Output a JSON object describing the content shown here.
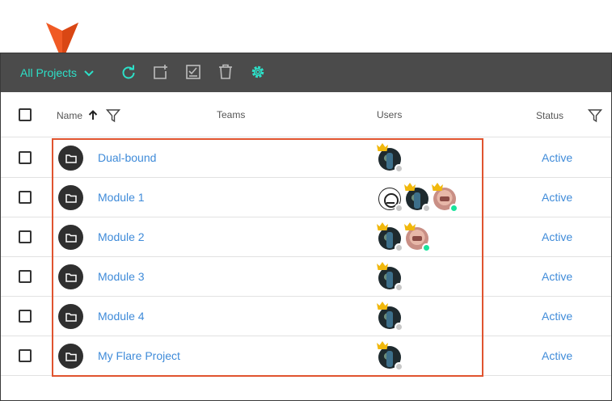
{
  "toolbar": {
    "project_select_label": "All Projects",
    "icons": [
      "refresh-icon",
      "add-project-icon",
      "checklist-icon",
      "delete-icon",
      "settings-icon"
    ]
  },
  "table": {
    "columns": {
      "name": "Name",
      "teams": "Teams",
      "users": "Users",
      "status": "Status"
    },
    "rows": [
      {
        "name": "Dual-bound",
        "status": "Active",
        "users": [
          {
            "avatar": "dark",
            "presence": "grey"
          }
        ]
      },
      {
        "name": "Module 1",
        "status": "Active",
        "users": [
          {
            "avatar": "sketch",
            "presence": "grey"
          },
          {
            "avatar": "dark",
            "presence": "grey"
          },
          {
            "avatar": "pink",
            "presence": "green"
          }
        ]
      },
      {
        "name": "Module 2",
        "status": "Active",
        "users": [
          {
            "avatar": "dark",
            "presence": "grey"
          },
          {
            "avatar": "pink",
            "presence": "green"
          }
        ]
      },
      {
        "name": "Module 3",
        "status": "Active",
        "users": [
          {
            "avatar": "dark",
            "presence": "grey"
          }
        ]
      },
      {
        "name": "Module 4",
        "status": "Active",
        "users": [
          {
            "avatar": "dark",
            "presence": "grey"
          }
        ]
      },
      {
        "name": "My Flare Project",
        "status": "Active",
        "users": [
          {
            "avatar": "dark",
            "presence": "grey"
          }
        ]
      }
    ]
  },
  "colors": {
    "accent": "#2de0c8",
    "link": "#3f8bd9",
    "toolbar_bg": "#4b4b4b",
    "highlight": "#e0542f",
    "online": "#19e39b"
  }
}
